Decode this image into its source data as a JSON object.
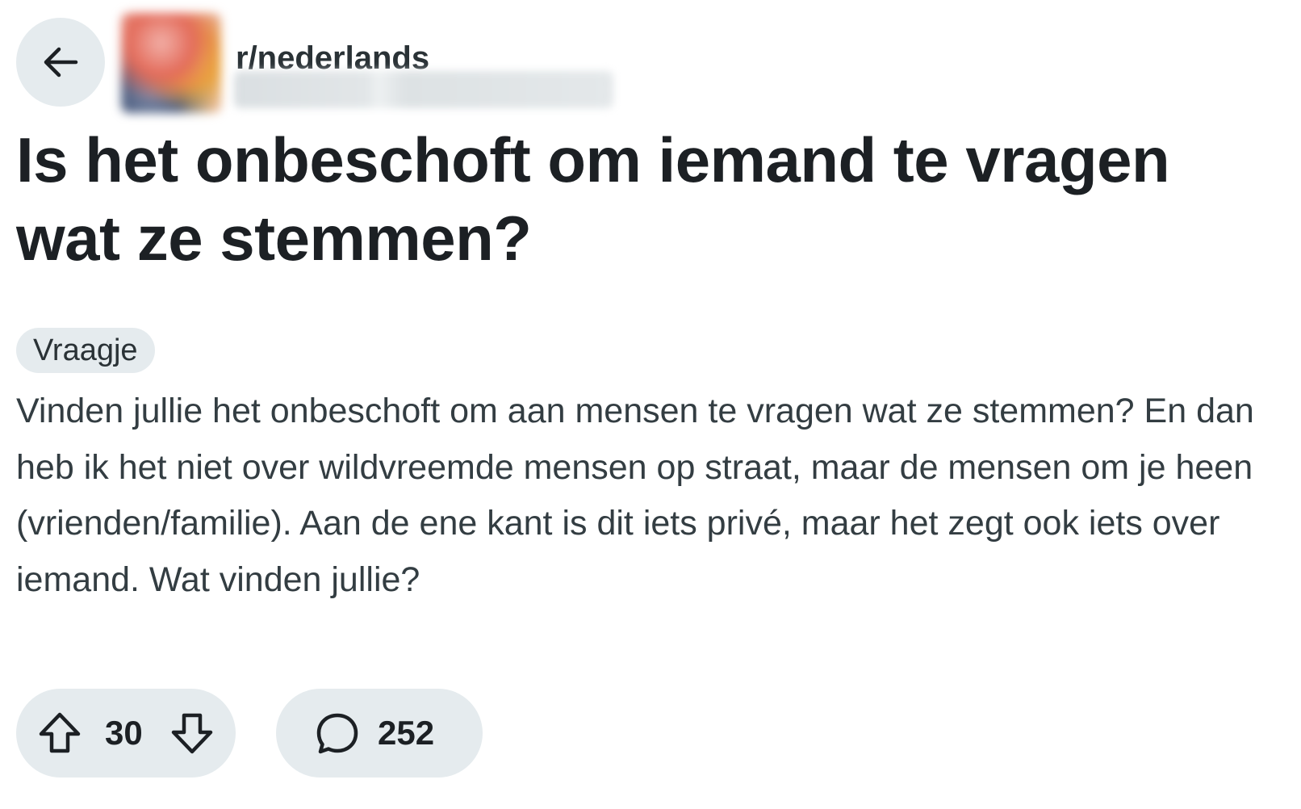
{
  "header": {
    "back_icon": "arrow-left-icon",
    "subreddit": "r/nederlands"
  },
  "post": {
    "title": "Is het onbeschoft om iemand te vragen wat ze stemmen?",
    "flair": "Vraagje",
    "body": "Vinden jullie het onbeschoft om aan mensen te vragen wat ze stemmen? En dan heb ik het niet over wildvreemde mensen op straat, maar de mensen om je heen (vrienden/familie). Aan de ene kant is dit iets privé, maar het zegt ook iets over iemand. Wat vinden jullie?"
  },
  "actions": {
    "upvote_icon": "upvote-arrow-icon",
    "vote_count": "30",
    "downvote_icon": "downvote-arrow-icon",
    "comment_icon": "speech-bubble-icon",
    "comment_count": "252"
  },
  "colors": {
    "pill_background": "#e5ebee",
    "title_text": "#1c2024",
    "body_text": "#333d42"
  }
}
